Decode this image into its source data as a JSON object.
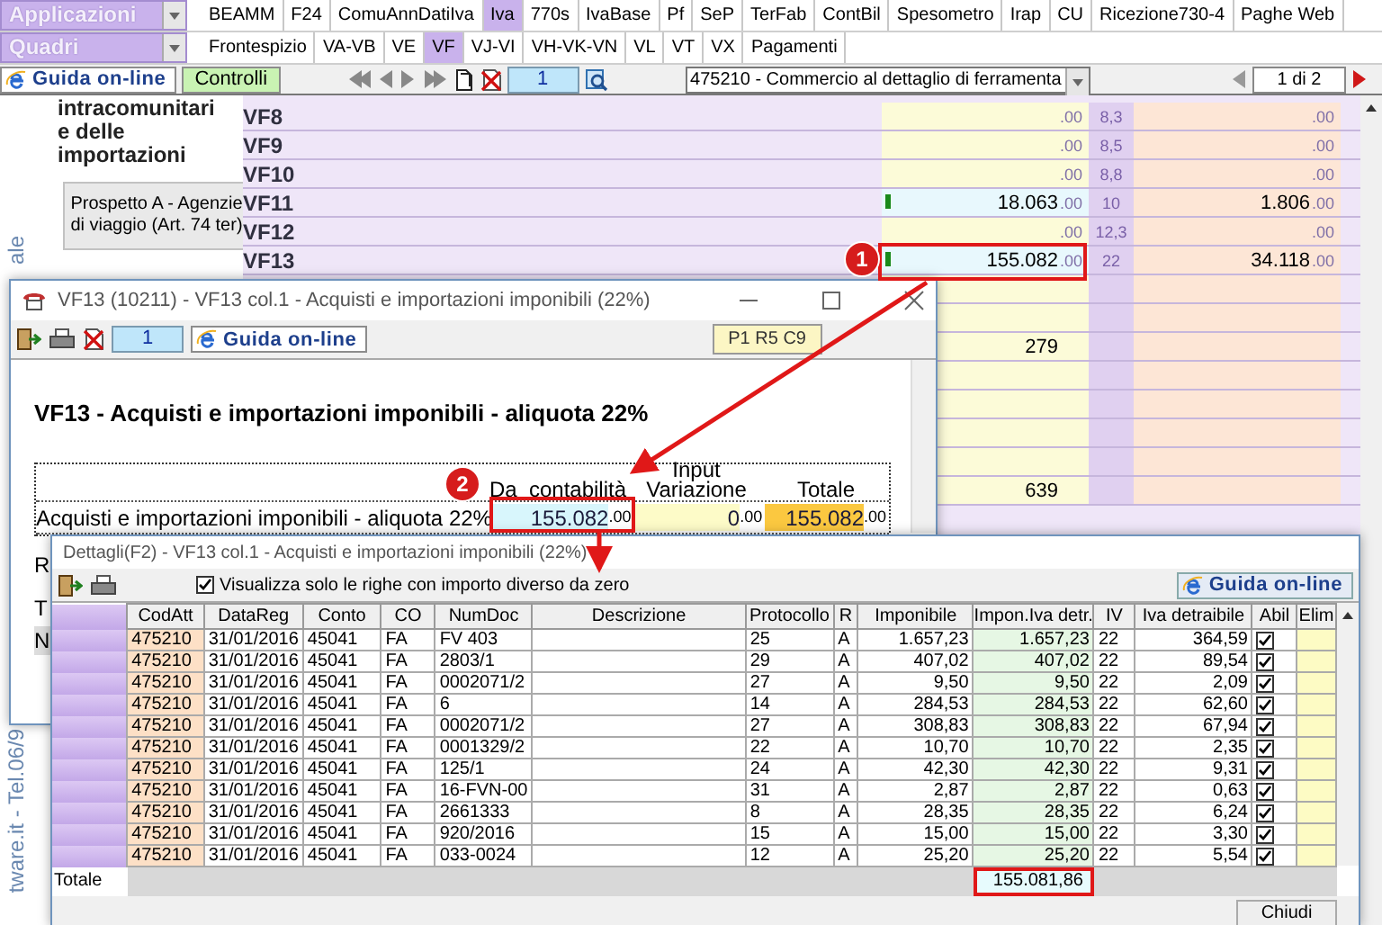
{
  "app_menu": {
    "label": "Applicazioni"
  },
  "apps": [
    {
      "label": "BEAMM",
      "selected": false
    },
    {
      "label": "F24",
      "selected": false
    },
    {
      "label": "ComuAnnDatiIva",
      "selected": false
    },
    {
      "label": "Iva",
      "selected": true
    },
    {
      "label": "770s",
      "selected": false
    },
    {
      "label": "IvaBase",
      "selected": false
    },
    {
      "label": "Pf",
      "selected": false
    },
    {
      "label": "SeP",
      "selected": false
    },
    {
      "label": "TerFab",
      "selected": false
    },
    {
      "label": "ContBil",
      "selected": false
    },
    {
      "label": "Spesometro",
      "selected": false
    },
    {
      "label": "Irap",
      "selected": false
    },
    {
      "label": "CU",
      "selected": false
    },
    {
      "label": "Ricezione730-4",
      "selected": false
    },
    {
      "label": "Paghe Web",
      "selected": false
    }
  ],
  "section_menu": {
    "label": "Quadri"
  },
  "sections": [
    {
      "label": "Frontespizio",
      "selected": false
    },
    {
      "label": "VA-VB",
      "selected": false
    },
    {
      "label": "VE",
      "selected": false
    },
    {
      "label": "VF",
      "selected": true
    },
    {
      "label": "VJ-VI",
      "selected": false
    },
    {
      "label": "VH-VK-VN",
      "selected": false
    },
    {
      "label": "VL",
      "selected": false
    },
    {
      "label": "VT",
      "selected": false
    },
    {
      "label": "VX",
      "selected": false
    },
    {
      "label": "Pagamenti",
      "selected": false
    }
  ],
  "toolbar": {
    "help": "Guida on-line",
    "checks": "Controlli",
    "page": "1",
    "activity": "475210 - Commercio al dettaglio di ferramenta",
    "pager": "1 di 2"
  },
  "sidebar": {
    "top_text": "ale",
    "bottom_text": "tware.it - Tel.06/9"
  },
  "panel": {
    "heading": "intracomunitari\ne delle importazioni",
    "button": "Prospetto A - Agenzie di viaggio (Art. 74 ter)"
  },
  "rows": [
    {
      "code": "VF8",
      "base": "",
      "base_dec": ".00",
      "rate": "8,3",
      "tax": "",
      "tax_dec": ".00"
    },
    {
      "code": "VF9",
      "base": "",
      "base_dec": ".00",
      "rate": "8,5",
      "tax": "",
      "tax_dec": ".00"
    },
    {
      "code": "VF10",
      "base": "",
      "base_dec": ".00",
      "rate": "8,8",
      "tax": "",
      "tax_dec": ".00"
    },
    {
      "code": "VF11",
      "base": "18.063",
      "base_dec": ".00",
      "rate": "10",
      "tax": "1.806",
      "tax_dec": ".00"
    },
    {
      "code": "VF12",
      "base": "",
      "base_dec": ".00",
      "rate": "12,3",
      "tax": "",
      "tax_dec": ".00"
    },
    {
      "code": "VF13",
      "base": "155.082",
      "base_dec": ".00",
      "rate": "22",
      "tax": "34.118",
      "tax_dec": ".00"
    }
  ],
  "lower_rows": [
    {
      "base": ""
    },
    {
      "base": ""
    },
    {
      "base": "279"
    },
    {
      "base": ""
    },
    {
      "base": ""
    },
    {
      "base": ""
    },
    {
      "base": ""
    },
    {
      "base": "639"
    }
  ],
  "dialog": {
    "title": "VF13 (10211) - VF13 col.1 - Acquisti e importazioni imponibili (22%)",
    "page": "1",
    "help": "Guida on-line",
    "cell_ref": "P1 R5 C9",
    "heading": "VF13 - Acquisti e importazioni imponibili - aliquota 22%",
    "columns": [
      "Da  contabilità",
      "Input\nVariazione",
      "Totale"
    ],
    "row": {
      "label": "Acquisti e importazioni imponibili - aliquota 22%",
      "values": [
        {
          "kind": "accounting",
          "value": "155.082",
          "dec": ".00"
        },
        {
          "kind": "input",
          "value": "0",
          "dec": ".00"
        },
        {
          "kind": "total",
          "value": "155.082",
          "dec": ".00"
        }
      ]
    },
    "partial_rows": [
      "R",
      "T",
      "N"
    ]
  },
  "details": {
    "title": "Dettagli(F2) - VF13 col.1 - Acquisti e importazioni imponibili (22%)",
    "filter": {
      "label": "Visualizza solo le righe con importo diverso da zero",
      "checked": true
    },
    "help": "Guida on-line",
    "columns": [
      "CodAtt",
      "DataReg",
      "Conto",
      "CO",
      "NumDoc",
      "Descrizione",
      "Protocollo",
      "R",
      "Imponibile",
      "Impon.Iva detr.",
      "IV",
      "Iva detraibile",
      "Abil",
      "Elim"
    ],
    "rows": [
      {
        "cod_att": "475210",
        "data_reg": "31/01/2016",
        "conto": "45041",
        "co": "FA",
        "num_doc": "FV 403",
        "protocollo": "25",
        "r": "A",
        "imponibile": "1.657,23",
        "impon_iva_detr": "1.657,23",
        "iv": "22",
        "iva_detraibile": "364,59",
        "enabled": true
      },
      {
        "cod_att": "475210",
        "data_reg": "31/01/2016",
        "conto": "45041",
        "co": "FA",
        "num_doc": "2803/1",
        "protocollo": "29",
        "r": "A",
        "imponibile": "407,02",
        "impon_iva_detr": "407,02",
        "iv": "22",
        "iva_detraibile": "89,54",
        "enabled": true
      },
      {
        "cod_att": "475210",
        "data_reg": "31/01/2016",
        "conto": "45041",
        "co": "FA",
        "num_doc": "0002071/2",
        "protocollo": "27",
        "r": "A",
        "imponibile": "9,50",
        "impon_iva_detr": "9,50",
        "iv": "22",
        "iva_detraibile": "2,09",
        "enabled": true
      },
      {
        "cod_att": "475210",
        "data_reg": "31/01/2016",
        "conto": "45041",
        "co": "FA",
        "num_doc": "6",
        "protocollo": "14",
        "r": "A",
        "imponibile": "284,53",
        "impon_iva_detr": "284,53",
        "iv": "22",
        "iva_detraibile": "62,60",
        "enabled": true
      },
      {
        "cod_att": "475210",
        "data_reg": "31/01/2016",
        "conto": "45041",
        "co": "FA",
        "num_doc": "0002071/2",
        "protocollo": "27",
        "r": "A",
        "imponibile": "308,83",
        "impon_iva_detr": "308,83",
        "iv": "22",
        "iva_detraibile": "67,94",
        "enabled": true
      },
      {
        "cod_att": "475210",
        "data_reg": "31/01/2016",
        "conto": "45041",
        "co": "FA",
        "num_doc": "0001329/2",
        "protocollo": "22",
        "r": "A",
        "imponibile": "10,70",
        "impon_iva_detr": "10,70",
        "iv": "22",
        "iva_detraibile": "2,35",
        "enabled": true
      },
      {
        "cod_att": "475210",
        "data_reg": "31/01/2016",
        "conto": "45041",
        "co": "FA",
        "num_doc": "125/1",
        "protocollo": "24",
        "r": "A",
        "imponibile": "42,30",
        "impon_iva_detr": "42,30",
        "iv": "22",
        "iva_detraibile": "9,31",
        "enabled": true
      },
      {
        "cod_att": "475210",
        "data_reg": "31/01/2016",
        "conto": "45041",
        "co": "FA",
        "num_doc": "16-FVN-00",
        "protocollo": "31",
        "r": "A",
        "imponibile": "2,87",
        "impon_iva_detr": "2,87",
        "iv": "22",
        "iva_detraibile": "0,63",
        "enabled": true
      },
      {
        "cod_att": "475210",
        "data_reg": "31/01/2016",
        "conto": "45041",
        "co": "FA",
        "num_doc": "2661333",
        "protocollo": "8",
        "r": "A",
        "imponibile": "28,35",
        "impon_iva_detr": "28,35",
        "iv": "22",
        "iva_detraibile": "6,24",
        "enabled": true
      },
      {
        "cod_att": "475210",
        "data_reg": "31/01/2016",
        "conto": "45041",
        "co": "FA",
        "num_doc": "920/2016",
        "protocollo": "15",
        "r": "A",
        "imponibile": "15,00",
        "impon_iva_detr": "15,00",
        "iv": "22",
        "iva_detraibile": "3,30",
        "enabled": true
      },
      {
        "cod_att": "475210",
        "data_reg": "31/01/2016",
        "conto": "45041",
        "co": "FA",
        "num_doc": "033-0024",
        "protocollo": "12",
        "r": "A",
        "imponibile": "25,20",
        "impon_iva_detr": "25,20",
        "iv": "22",
        "iva_detraibile": "5,54",
        "enabled": true
      }
    ],
    "total_label": "Totale",
    "total": "155.081,86",
    "close": "Chiudi"
  },
  "callouts": [
    {
      "label": "1"
    },
    {
      "label": "2"
    }
  ]
}
